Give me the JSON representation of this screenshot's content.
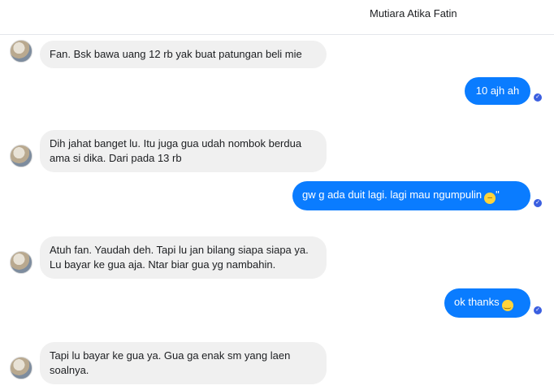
{
  "header": {
    "contact_name": "Mutiara Atika Fatin"
  },
  "messages": [
    {
      "sender": "them",
      "text": "Fan. Bsk bawa uang 12 rb yak buat patungan beli mie"
    },
    {
      "sender": "me",
      "text": "10 ajh ah"
    },
    {
      "sender": "them",
      "text": "Dih jahat banget lu. Itu juga gua udah nombok berdua ama si dika. Dari pada 13 rb"
    },
    {
      "sender": "me",
      "text": "gw g ada duit lagi. lagi mau ngumpulin",
      "emoji": "😑",
      "suffix": "\""
    },
    {
      "sender": "them",
      "text": "Atuh fan. Yaudah deh. Tapi lu jan bilang siapa siapa ya. Lu bayar ke gua aja. Ntar biar gua yg nambahin."
    },
    {
      "sender": "me",
      "text": "ok thanks",
      "emoji": "🙂"
    },
    {
      "sender": "them",
      "text": "Tapi lu bayar ke gua ya. Gua ga enak sm yang laen soalnya."
    }
  ],
  "icons": {
    "seen": "check-circle-icon",
    "avatar": "avatar"
  },
  "colors": {
    "outgoing_bubble": "#0a7cff",
    "incoming_bubble": "#f0f0f0",
    "seen_indicator": "#3b5fe0"
  }
}
